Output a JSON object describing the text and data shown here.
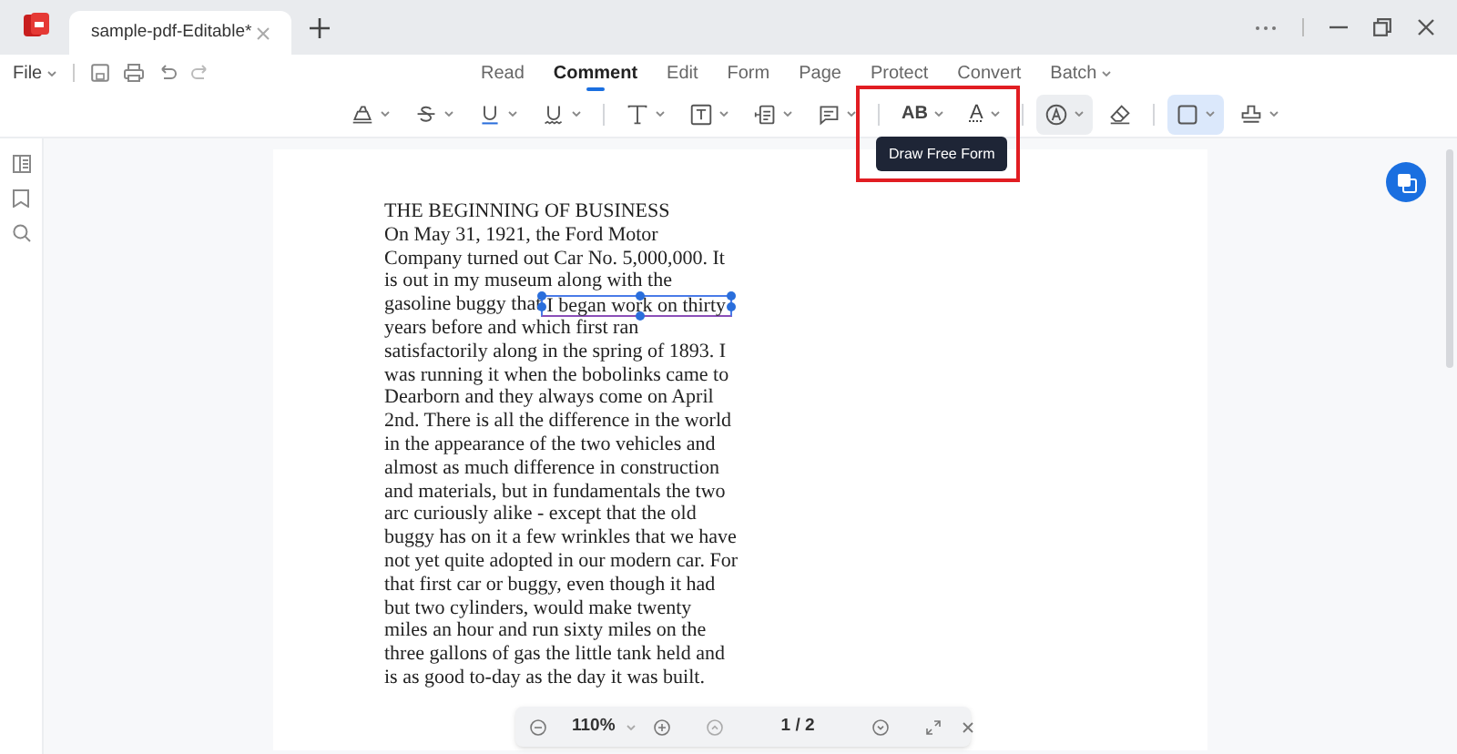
{
  "app_tabs": [
    {
      "title": "sample-pdf-Editable*",
      "selected": true
    }
  ],
  "file_menu": {
    "label": "File"
  },
  "mode_tabs": [
    {
      "label": "Read",
      "selected": false,
      "dropdown": false
    },
    {
      "label": "Comment",
      "selected": true,
      "dropdown": false
    },
    {
      "label": "Edit",
      "selected": false,
      "dropdown": false
    },
    {
      "label": "Form",
      "selected": false,
      "dropdown": false
    },
    {
      "label": "Page",
      "selected": false,
      "dropdown": false
    },
    {
      "label": "Protect",
      "selected": false,
      "dropdown": false
    },
    {
      "label": "Convert",
      "selected": false,
      "dropdown": false
    },
    {
      "label": "Batch",
      "selected": false,
      "dropdown": true
    }
  ],
  "tools": [
    {
      "kind": "highlight",
      "dropdown": true,
      "selected": false,
      "hovered": false
    },
    {
      "kind": "strikethrough",
      "dropdown": true,
      "selected": false,
      "hovered": false
    },
    {
      "kind": "underline",
      "dropdown": true,
      "selected": false,
      "hovered": false
    },
    {
      "kind": "squiggly",
      "dropdown": true,
      "selected": false,
      "hovered": false
    },
    {
      "kind": "divider"
    },
    {
      "kind": "text",
      "dropdown": true,
      "selected": false,
      "hovered": false
    },
    {
      "kind": "textbox",
      "dropdown": true,
      "selected": false,
      "hovered": false
    },
    {
      "kind": "callout",
      "dropdown": true,
      "selected": false,
      "hovered": false
    },
    {
      "kind": "note",
      "dropdown": true,
      "selected": false,
      "hovered": false
    },
    {
      "kind": "divider"
    },
    {
      "kind": "replace",
      "glyph": "AB",
      "dropdown": true,
      "selected": false,
      "hovered": false
    },
    {
      "kind": "insert",
      "glyph": "A",
      "dropdown": true,
      "selected": false,
      "hovered": false
    },
    {
      "kind": "divider"
    },
    {
      "kind": "pencil",
      "dropdown": true,
      "selected": false,
      "hovered": true
    },
    {
      "kind": "eraser",
      "dropdown": false,
      "selected": false,
      "hovered": false
    },
    {
      "kind": "divider"
    },
    {
      "kind": "rectangle",
      "dropdown": true,
      "selected": true,
      "hovered": false
    },
    {
      "kind": "stamp",
      "dropdown": true,
      "selected": false,
      "hovered": false
    }
  ],
  "tooltip": {
    "text": "Draw Free Form"
  },
  "highlight_box": true,
  "document_lines": [
    {
      "text": "THE BEGINNING OF BUSINESS"
    },
    {
      "text": "On May 31, 1921, the Ford Motor"
    },
    {
      "text": "Company turned out Car No. 5,000,000. It"
    },
    {
      "text": "is out in my museum along with the"
    },
    {
      "text": "gasoline buggy that",
      "annotation": "I began work on thirty"
    },
    {
      "text": "years before and which first ran"
    },
    {
      "text": "satisfactorily along in the spring of 1893. I"
    },
    {
      "text": "was running it when the bobolinks came to"
    },
    {
      "text": "Dearborn and they always come on April"
    },
    {
      "text": "2nd. There is all the difference in the world"
    },
    {
      "text": "in the appearance of the two vehicles and"
    },
    {
      "text": "almost as much difference in construction"
    },
    {
      "text": "and materials, but in fundamentals the two"
    },
    {
      "text": "arc curiously alike - except that the old"
    },
    {
      "text": "buggy has on it a few wrinkles that we have"
    },
    {
      "text": "not yet quite adopted in our modern car. For"
    },
    {
      "text": "that first car or buggy, even though it had"
    },
    {
      "text": "but two cylinders, would make twenty"
    },
    {
      "text": "miles an hour and run sixty miles on the"
    },
    {
      "text": "three gallons of gas the little tank held and"
    },
    {
      "text": "is as good to-day as the day it was built."
    }
  ],
  "zoom_bar": {
    "zoom": "110%",
    "page": "1 / 2"
  }
}
